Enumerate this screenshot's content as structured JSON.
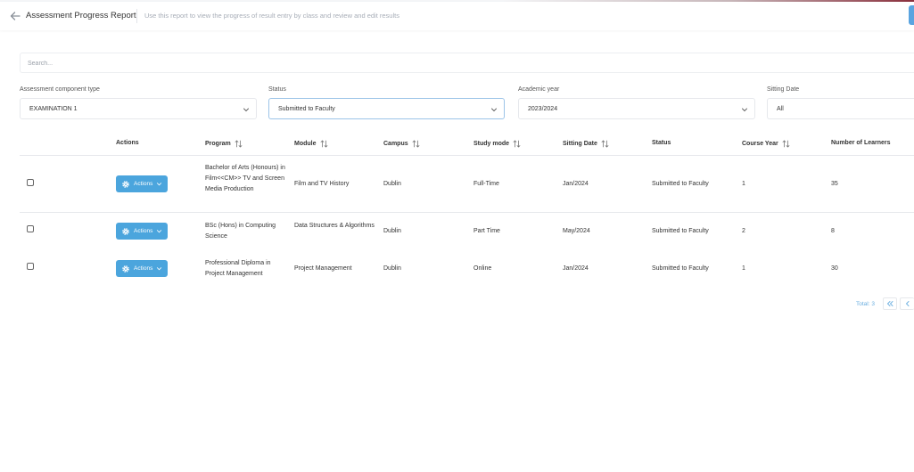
{
  "header": {
    "title": "Assessment Progress Report",
    "description": "Use this report to view the progress of result entry by class and review and edit results"
  },
  "search": {
    "placeholder": "Search..."
  },
  "filters": {
    "component_type": {
      "label": "Assessment component type",
      "value": "EXAMINATION 1"
    },
    "status": {
      "label": "Status",
      "value": "Submitted to Faculty"
    },
    "academic_year": {
      "label": "Academic year",
      "value": "2023/2024"
    },
    "sitting_date": {
      "label": "Sitting Date",
      "value": "All"
    }
  },
  "table": {
    "columns": {
      "actions": "Actions",
      "program": "Program",
      "module": "Module",
      "campus": "Campus",
      "study_mode": "Study mode",
      "sitting_date": "Sitting Date",
      "status": "Status",
      "course_year": "Course Year",
      "learners": "Number of Learners"
    },
    "action_label": "Actions",
    "rows": [
      {
        "program": "Bachelor of Arts (Honours) in Film<<CM>> TV and Screen Media Production",
        "module": "Film and TV History",
        "campus": "Dublin",
        "study_mode": "Full-Time",
        "sitting_date": "Jan/2024",
        "status": "Submitted to Faculty",
        "course_year": "1",
        "learners": "35"
      },
      {
        "program": "BSc (Hons) in Computing Science",
        "module": "Data Structures & Algorithms",
        "campus": "Dublin",
        "study_mode": "Part Time",
        "sitting_date": "May/2024",
        "status": "Submitted to Faculty",
        "course_year": "2",
        "learners": "8"
      },
      {
        "program": "Professional Diploma in Project Management",
        "module": "Project Management",
        "campus": "Dublin",
        "study_mode": "Online",
        "sitting_date": "Jan/2024",
        "status": "Submitted to Faculty",
        "course_year": "1",
        "learners": "30"
      }
    ]
  },
  "pagination": {
    "total": "Total: 3"
  },
  "colors": {
    "accent": "#4ba5dd",
    "link": "#6aaee0"
  },
  "icons": [
    "arrow-left-icon",
    "chevron-down-icon",
    "sort-icon",
    "gear-icon",
    "double-chevron-left-icon",
    "chevron-left-icon"
  ]
}
